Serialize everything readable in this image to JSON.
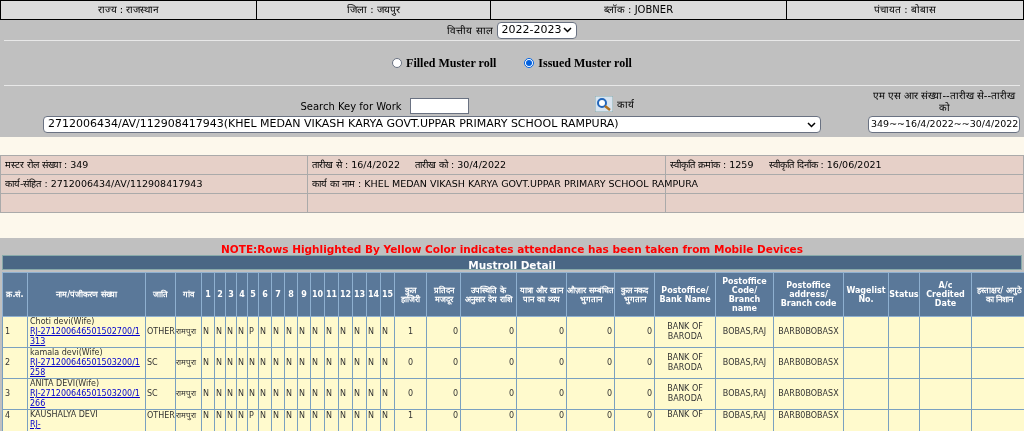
{
  "location_bar": [
    {
      "text": "राज्य : राजस्थान"
    },
    {
      "text": "जिला : जयपुर"
    },
    {
      "text": "ब्लॉक : JOBNER"
    },
    {
      "text": "पंचायत : बोबास"
    }
  ],
  "financial_year": {
    "label": "वित्तीय साल",
    "value": "2022-2023"
  },
  "radios": [
    {
      "label": "Filled Muster roll",
      "selected": false
    },
    {
      "label": "Issued Muster roll",
      "selected": true
    }
  ],
  "search": {
    "label": "Search Key for Work",
    "work_label": "कार्य",
    "work_value": "2712006434/AV/112908417943(KHEL MEDAN VIKASH KARYA GOVT.UPPAR PRIMARY SCHOOL RAMPURA)",
    "msr_label": "एम एस आर संख्या--तारीख से--तारीख को",
    "msr_value": "349~~16/4/2022~~30/4/2022"
  },
  "info_rows": [
    [
      "मस्टर रोल संख्या : 349",
      "तारीख से : 16/4/2022     तारीख को : 30/4/2022",
      "स्वीकृति क्रमांक : 1259     स्वीकृति दिनाँक : 16/06/2021"
    ],
    [
      "कार्य-संहित : 2712006434/AV/112908417943",
      "कार्य का नाम : KHEL MEDAN VIKASH KARYA GOVT.UPPAR PRIMARY SCHOOL RAMPURA",
      ""
    ]
  ],
  "note": "NOTE:Rows Highlighted By Yellow Color indicates attendance has been taken from Mobile Devices",
  "table": {
    "title": "Mustroll Detail",
    "columns": [
      "क्र.सं.",
      "नाम/पंजीकरण संख्या",
      "जाति",
      "गांव",
      "1",
      "2",
      "3",
      "4",
      "5",
      "6",
      "7",
      "8",
      "9",
      "10",
      "11",
      "12",
      "13",
      "14",
      "15",
      "कुल हाजिरी",
      "प्रतिदन मजदूर",
      "उपस्थिति के अनुसार देय राशि",
      "यात्रा और खान पान का व्यय",
      "औज़ार सम्बंधित भुगतान",
      "कुल नकद भुगतान",
      "Postoffice/ Bank Name",
      "Postoffice Code/ Branch name",
      "Postoffice address/ Branch code",
      "Wagelist No.",
      "Status",
      "A/c Credited Date",
      "हस्ताक्षर/ अगुठे का निशान"
    ],
    "rows": [
      {
        "sr": "1",
        "name": "Choti devi(Wife)",
        "reg": "RJ-271200646501502700/1313",
        "caste": "OTHER",
        "village": "रामपुरा",
        "days": [
          "N",
          "N",
          "N",
          "N",
          "P",
          "N",
          "N",
          "N",
          "N",
          "N",
          "N",
          "N",
          "N",
          "N",
          "N"
        ],
        "total": "1",
        "daily": "0",
        "payable": "0",
        "travel": "0",
        "tools": "0",
        "cash": "0",
        "bank": "BANK OF BARODA",
        "branch": "BOBAS,RAJ",
        "code": "BARB0BOBASX"
      },
      {
        "sr": "2",
        "name": "kamala devi(Wife)",
        "reg": "RJ-271200646501503200/1258",
        "caste": "SC",
        "village": "रामपुरा",
        "days": [
          "N",
          "N",
          "N",
          "N",
          "N",
          "N",
          "N",
          "N",
          "N",
          "N",
          "N",
          "N",
          "N",
          "N",
          "N"
        ],
        "total": "0",
        "daily": "0",
        "payable": "0",
        "travel": "0",
        "tools": "0",
        "cash": "0",
        "bank": "BANK OF BARODA",
        "branch": "BOBAS,RAJ",
        "code": "BARB0BOBASX"
      },
      {
        "sr": "3",
        "name": "ANITA DEVI(Wife)",
        "reg": "RJ-271200646501503200/1266",
        "caste": "SC",
        "village": "रामपुरा",
        "days": [
          "N",
          "N",
          "N",
          "N",
          "N",
          "N",
          "N",
          "N",
          "N",
          "N",
          "N",
          "N",
          "N",
          "N",
          "N"
        ],
        "total": "0",
        "daily": "0",
        "payable": "0",
        "travel": "0",
        "tools": "0",
        "cash": "0",
        "bank": "BANK OF BARODA",
        "branch": "BOBAS,RAJ",
        "code": "BARB0BOBASX"
      },
      {
        "sr": "4",
        "name": "KAUSHALYA DEVI",
        "reg": "RJ-",
        "caste": "OTHER",
        "village": "रामपुरा",
        "days": [
          "N",
          "N",
          "N",
          "N",
          "P",
          "N",
          "N",
          "N",
          "N",
          "N",
          "N",
          "N",
          "N",
          "N",
          "N"
        ],
        "total": "1",
        "daily": "0",
        "payable": "0",
        "travel": "0",
        "tools": "0",
        "cash": "0",
        "bank": "BANK OF",
        "branch": "BOBAS,RAJ",
        "code": "BARB0BOBASX"
      }
    ]
  }
}
